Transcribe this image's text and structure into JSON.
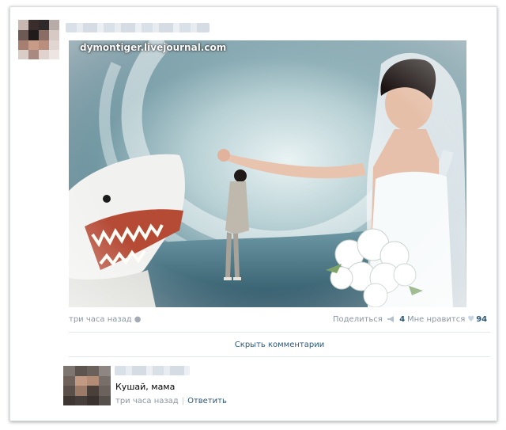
{
  "post": {
    "watermark": "dymontiger.livejournal.com",
    "time": "три часа назад",
    "share_label": "Поделиться",
    "share_count": "4",
    "like_label": "Мне нравится",
    "like_count": "94",
    "hide_comments_label": "Скрыть комментарии",
    "icons": {
      "platform": "apple-icon",
      "share": "megaphone-icon",
      "like": "heart-icon"
    }
  },
  "comment": {
    "text": "Кушай, мама",
    "time": "три часа назад",
    "reply_label": "Ответить"
  },
  "colors": {
    "link": "#2b587a",
    "meta": "#8b96a3",
    "frame_border": "#d9dce0"
  }
}
